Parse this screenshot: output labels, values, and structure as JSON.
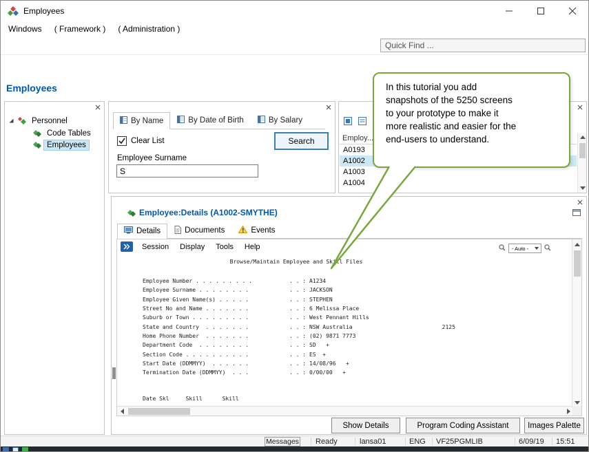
{
  "window": {
    "title": "Employees"
  },
  "menu_bar": {
    "items": [
      {
        "label": "Windows"
      },
      {
        "label": "( Framework )"
      },
      {
        "label": "( Administration )"
      }
    ]
  },
  "toolbar": {
    "quick_find": "Quick Find ..."
  },
  "page": {
    "title": "Employees"
  },
  "tree_panel": {
    "root": {
      "label": "Personnel"
    },
    "children": [
      {
        "label": "Code Tables"
      },
      {
        "label": "Employees",
        "selected": true
      }
    ]
  },
  "filter_panel": {
    "tabs": [
      {
        "label": "By Name",
        "active": true
      },
      {
        "label": "By Date of Birth"
      },
      {
        "label": "By Salary"
      }
    ],
    "clear_list": "Clear List",
    "clear_list_checked": true,
    "search_button": "Search",
    "surname_label": "Employee Surname",
    "surname_value": "S"
  },
  "list_panel": {
    "header": "Employ...",
    "rows": [
      {
        "id": "A0193"
      },
      {
        "id": "A1002",
        "selected": true
      },
      {
        "id": "A1003"
      },
      {
        "id": "A1004"
      }
    ]
  },
  "callout": {
    "text": "In this tutorial you add\nsnapshots of the 5250 screens\nto your prototype to make it\nmore realistic and easier for the\nend-users to understand."
  },
  "details_panel": {
    "title": "Employee:Details (A1002-SMYTHE)",
    "tabs": [
      {
        "label": "Details",
        "active": true
      },
      {
        "label": "Documents"
      },
      {
        "label": "Events"
      }
    ],
    "screen": {
      "menu": [
        {
          "label": "Session"
        },
        {
          "label": "Display"
        },
        {
          "label": "Tools"
        },
        {
          "label": "Help"
        }
      ],
      "zoom_value": "- Auto -",
      "title": "Browse/Maintain Employee and Skill Files",
      "fields": [
        {
          "label": "Employee Number . . . . . . . . .",
          "sep": ". . :",
          "value": "A1234"
        },
        {
          "label": "Employee Surname . . . . . . . .",
          "sep": ". . :",
          "value": "JACKSON"
        },
        {
          "label": "Employee Given Name(s) . . . . .",
          "sep": ". . :",
          "value": "STEPHEN"
        },
        {
          "label": "Street No and Name . . . . . . .",
          "sep": ". . :",
          "value": "6 Melissa Place"
        },
        {
          "label": "Suburb or Town . . . . . . . . .",
          "sep": ". . :",
          "value": "West Pennant Hills"
        },
        {
          "label": "State and Country  . . . . . . .",
          "sep": ". . :",
          "value": "NSW Australia                           2125"
        },
        {
          "label": "Home Phone Number  . . . . . . .",
          "sep": ". . :",
          "value": "(02) 9871 7773"
        },
        {
          "label": "Department Code  . . . . . . . .",
          "sep": ". . :",
          "value": "SD   +"
        },
        {
          "label": "Section Code . . . . . . . . . .",
          "sep": ". . :",
          "value": "ES  +"
        },
        {
          "label": "Start Date (DDMMYY)  . . . . . .",
          "sep": ". . :",
          "value": "14/08/96   +"
        },
        {
          "label": "Termination Date (DDMMYY)  . . .",
          "sep": ". . :",
          "value": "0/00/00   +"
        }
      ],
      "footer": "Date Skl     Skill      Skill"
    }
  },
  "action_buttons": [
    {
      "label": "Show Details"
    },
    {
      "label": "Program Coding Assistant"
    },
    {
      "label": "Images Palette"
    }
  ],
  "status_bar": {
    "messages": "Messages",
    "state": "Ready",
    "server": "lansa01",
    "language": "ENG",
    "library": "VF25PGMLIB",
    "date": "6/09/19",
    "time": "15:51"
  },
  "colors": {
    "accent_blue": "#0057ae",
    "selection_blue": "#cbe8f6",
    "callout_green": "#79a73e",
    "warning_yellow": "#ffd83b"
  }
}
